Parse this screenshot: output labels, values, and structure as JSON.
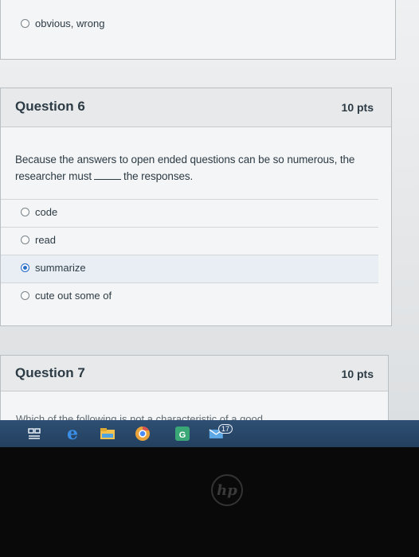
{
  "prev_question": {
    "answer_label": "obvious, wrong"
  },
  "question6": {
    "title": "Question 6",
    "points": "10 pts",
    "text_before": "Because the answers to open ended questions can be so numerous, the researcher must",
    "text_after": "the responses.",
    "answers": [
      {
        "label": "code",
        "selected": false
      },
      {
        "label": "read",
        "selected": false
      },
      {
        "label": "summarize",
        "selected": true
      },
      {
        "label": "cute out some of",
        "selected": false
      }
    ]
  },
  "question7": {
    "title": "Question 7",
    "points": "10 pts",
    "text_partial": "Which of the following is not a characteristic of a good"
  },
  "taskbar": {
    "badge_count": "17",
    "icons": [
      "task-view-icon",
      "edge-icon",
      "file-explorer-icon",
      "chrome-icon",
      "app-icon",
      "mail-icon"
    ]
  },
  "device": {
    "logo": "hp"
  },
  "colors": {
    "accent": "#2b6fc7",
    "taskbar": "#2e4f73",
    "text": "#2d3b45"
  }
}
